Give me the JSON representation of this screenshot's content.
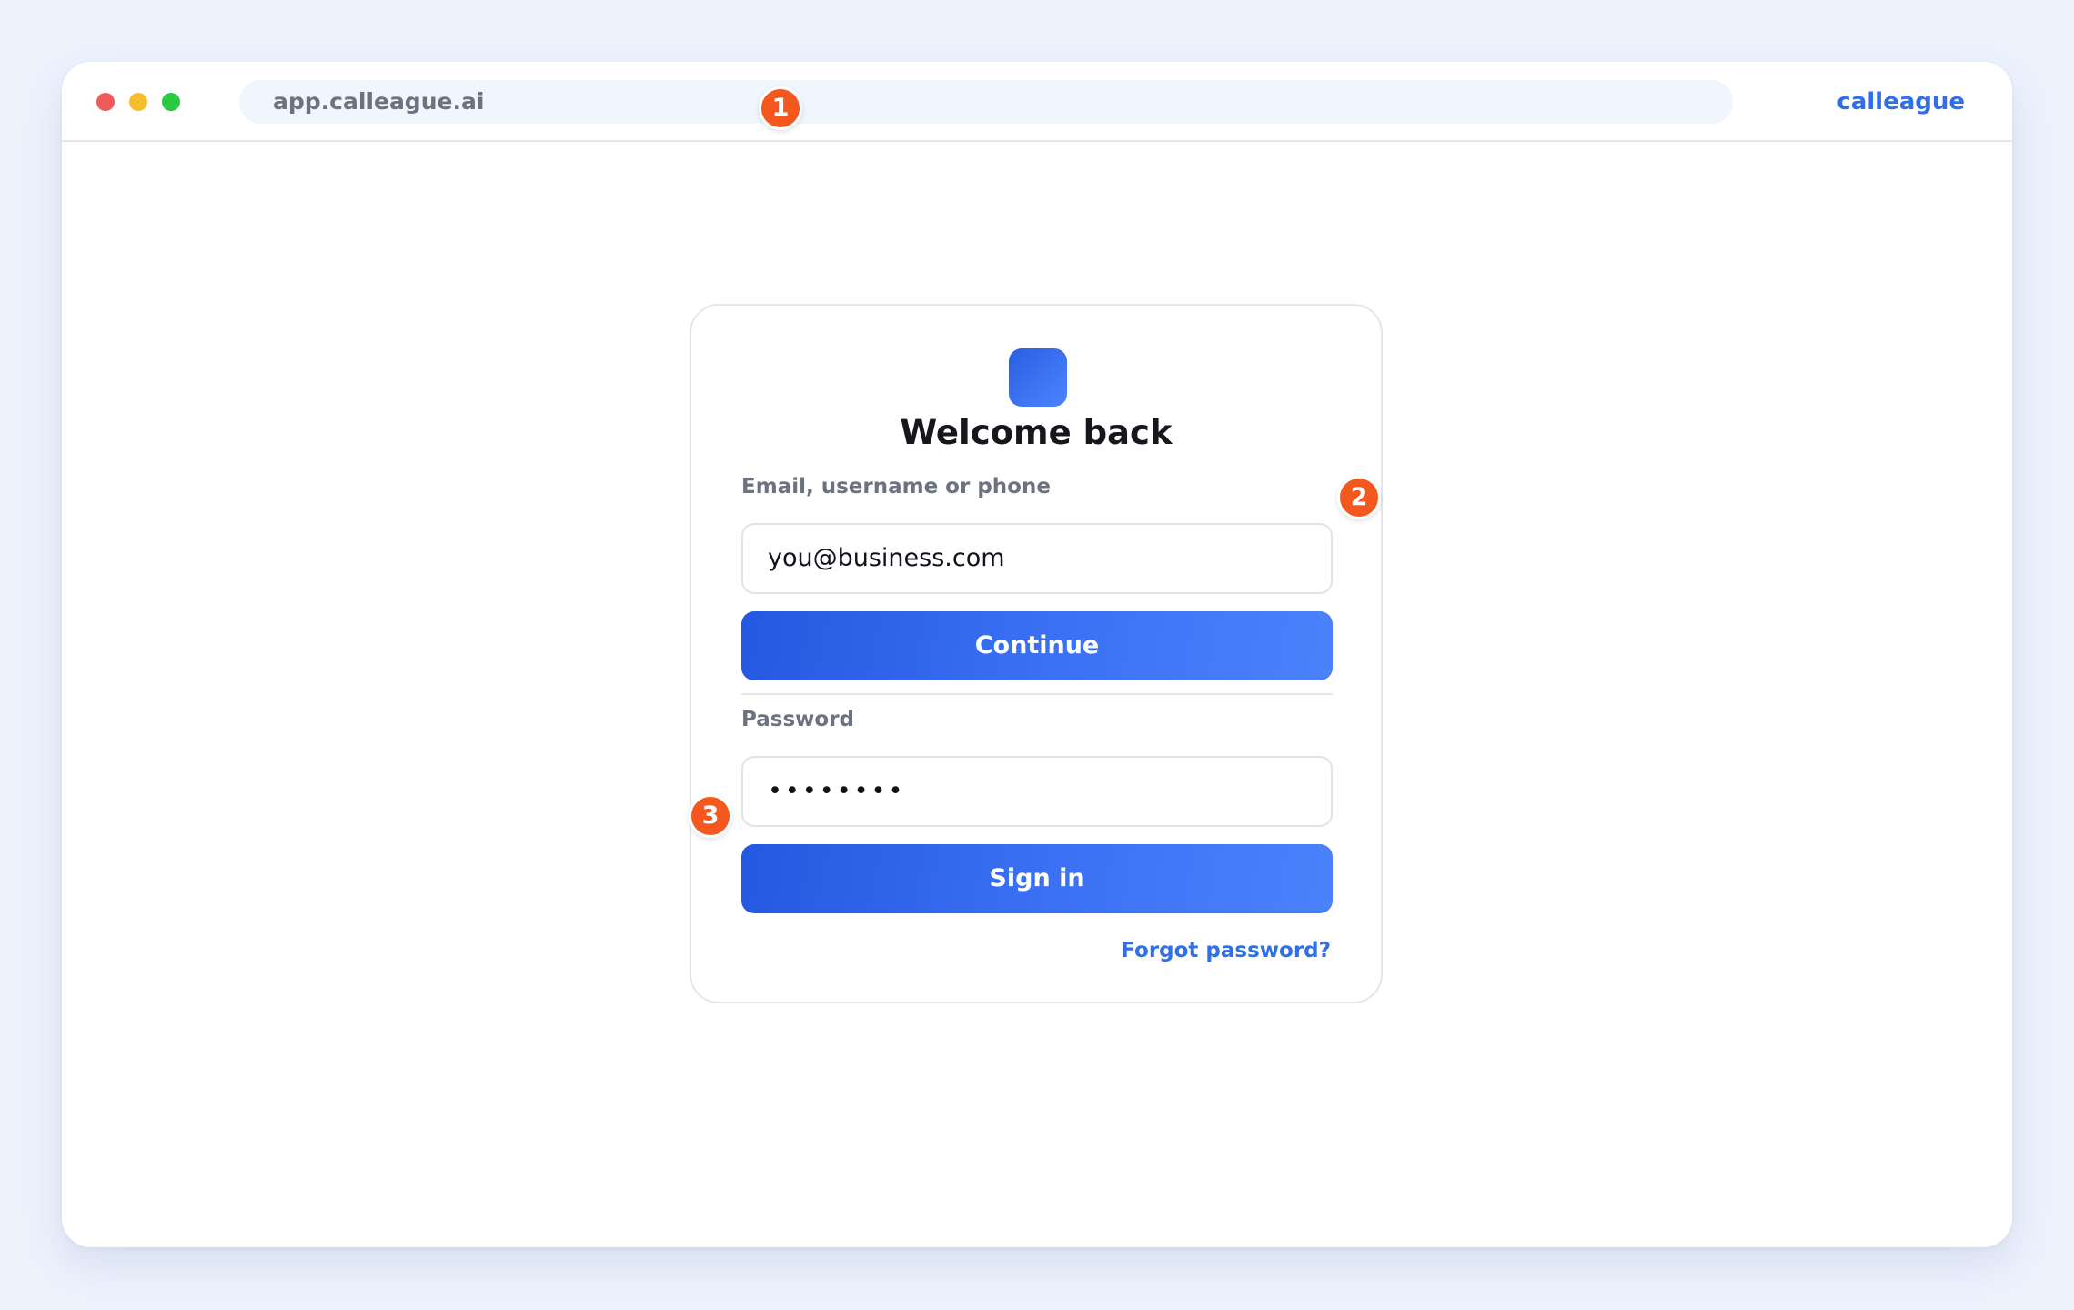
{
  "window": {
    "traffic_lights": [
      "close",
      "minimize",
      "zoom"
    ],
    "url": "app.calleague.ai",
    "brand": "calleague"
  },
  "login": {
    "title": "Welcome back",
    "email_label": "Email, username or phone",
    "email_value": "you@business.com",
    "continue_label": "Continue",
    "password_label": "Password",
    "password_value": "••••••••",
    "signin_label": "Sign in",
    "forgot_label": "Forgot password?"
  },
  "markers": [
    "1",
    "2",
    "3"
  ],
  "colors": {
    "accent": "#2f6fe8",
    "button_start": "#2458e0",
    "button_end": "#4a82fb",
    "marker": "#f5581e",
    "background": "#edf2fd"
  }
}
